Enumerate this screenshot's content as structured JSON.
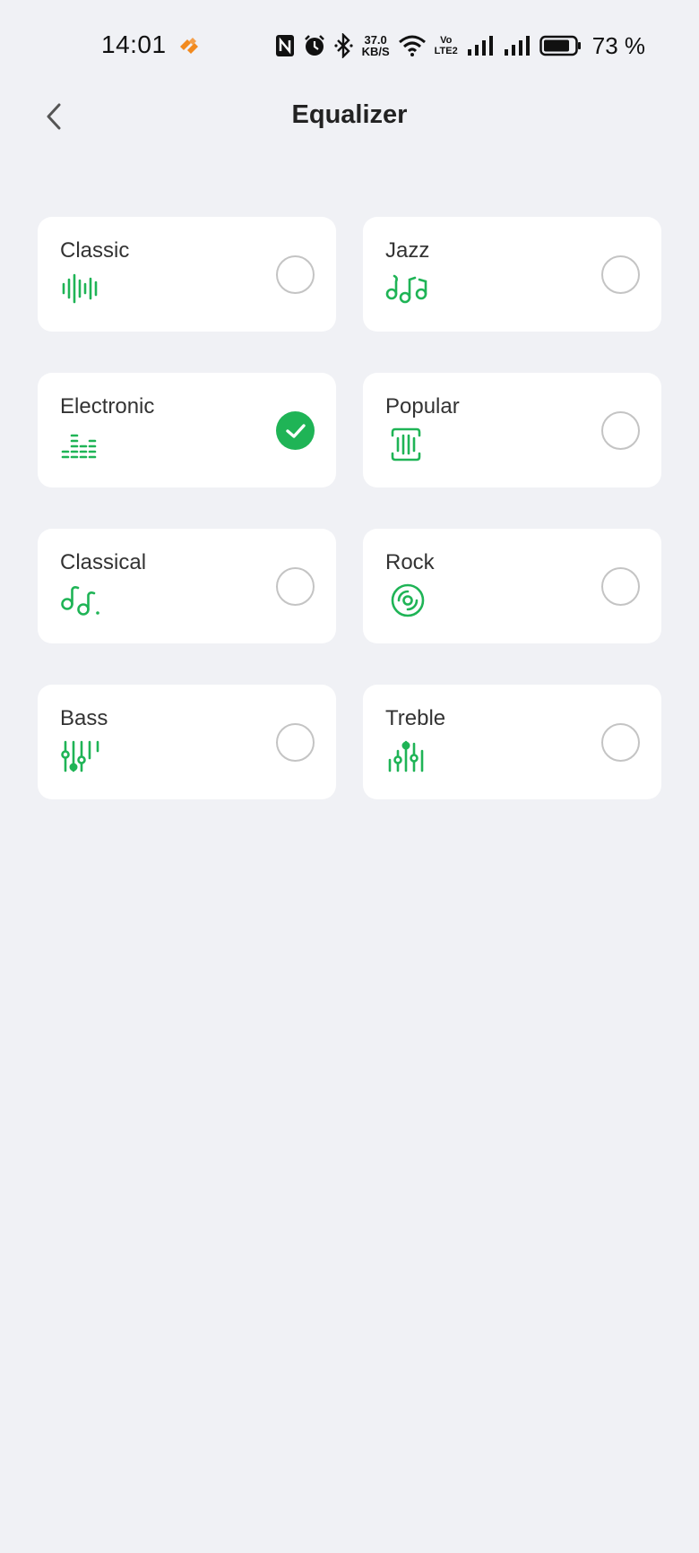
{
  "status_bar": {
    "time": "14:01",
    "net_speed_value": "37.0",
    "net_speed_unit": "KB/S",
    "volte_top": "Vo",
    "volte_bottom": "LTE2",
    "battery_percent": "73 %"
  },
  "header": {
    "title": "Equalizer"
  },
  "colors": {
    "accent": "#1fb456",
    "background": "#f0f1f5",
    "card": "#ffffff",
    "app_icon": "#f28a1e"
  },
  "presets": [
    {
      "label": "Classic",
      "icon": "waveform-icon",
      "selected": false
    },
    {
      "label": "Jazz",
      "icon": "music-notes-icon",
      "selected": false
    },
    {
      "label": "Electronic",
      "icon": "equalizer-bars-icon",
      "selected": true
    },
    {
      "label": "Popular",
      "icon": "audio-frame-icon",
      "selected": false
    },
    {
      "label": "Classical",
      "icon": "double-notes-icon",
      "selected": false
    },
    {
      "label": "Rock",
      "icon": "vinyl-disc-icon",
      "selected": false
    },
    {
      "label": "Bass",
      "icon": "bass-sliders-icon",
      "selected": false
    },
    {
      "label": "Treble",
      "icon": "treble-sliders-icon",
      "selected": false
    }
  ]
}
